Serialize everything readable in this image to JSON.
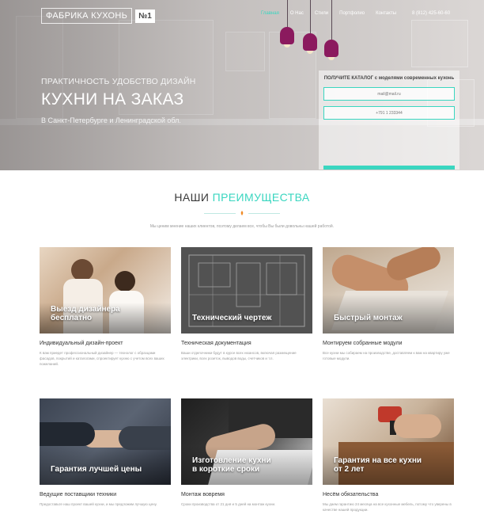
{
  "header": {
    "logo_text": "ФАБРИКА КУХОНЬ",
    "logo_num": "№1",
    "nav": [
      "Главная",
      "О Нас",
      "Стили",
      "Портфолио",
      "Контакты"
    ],
    "phone": "8 (812) 425-60-60"
  },
  "hero": {
    "subtitle": "ПРАКТИЧНОСТЬ УДОБСТВО ДИЗАЙН",
    "title": "КУХНИ НА ЗАКАЗ",
    "city": "В Санкт-Петербурге и Ленинградской обл."
  },
  "form": {
    "title": "ПОЛУЧИТЕ КАТАЛОГ с моделями современных кухонь",
    "email_placeholder": "mail@mail.ru",
    "phone_placeholder": "+791 1 233344"
  },
  "section": {
    "title_plain": "НАШИ",
    "title_accent": "ПРЕИМУЩЕСТВА",
    "description": "Мы ценим мнение наших клиентов, поэтому делаем все, чтобы Вы были довольны нашей работой.",
    "cards": [
      {
        "label_line1": "Выезд дизайнера",
        "label_line2": "бесплатно",
        "title": "Индивидуальный дизайн-проект",
        "text": "К вам приедет профессиональный дизайнер — технолог с образцами фасадов, покрытий и каталогами, спроектирует кухню с учетом всех ваших пожеланий."
      },
      {
        "label_line1": "Технический чертеж",
        "label_line2": "",
        "title": "Техническая документация",
        "text": "Ваши отделочники будут в курсе всех нюансов, включая размещение электрики, всех розеток, выводов воды, счетчиков и т.п."
      },
      {
        "label_line1": "Быстрый монтаж",
        "label_line2": "",
        "title": "Монтируем собранные модули",
        "text": "Все кухни мы собираем на производстве, доставляем к вам на квартиру уже готовые модули."
      },
      {
        "label_line1": "Гарантия лучшей цены",
        "label_line2": "",
        "title": "Ведущие поставщики техники",
        "text": "Предоставьте наш проект вашей кухни, и мы предложим лучшую цену."
      },
      {
        "label_line1": "Изготовление кухни",
        "label_line2": "в короткие сроки",
        "title": "Монтаж вовремя",
        "text": "Сроки производства от 21 дня и 5 дней на монтаж кухни."
      },
      {
        "label_line1": "Гарантия на все кухни",
        "label_line2": "от 2 лет",
        "title": "Несём обязательства",
        "text": "Мы даем гарантию 24 месяца на все кухонные мебель, потому что уверены в качестве нашей продукции."
      }
    ]
  },
  "colors": {
    "accent": "#3ad6c0",
    "lamp": "#8b1a5e",
    "dot": "#f08a24"
  }
}
